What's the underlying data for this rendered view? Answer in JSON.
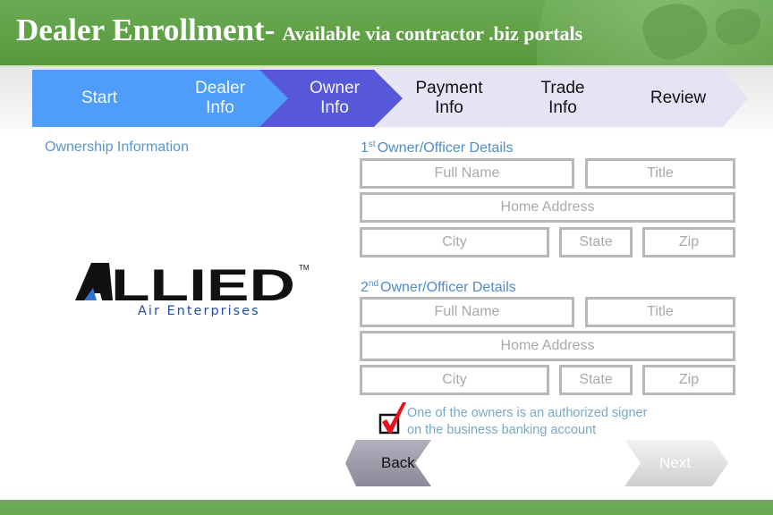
{
  "header": {
    "title": "Dealer Enrollment-",
    "subtitle": "Available via contractor .biz portals"
  },
  "steps": [
    {
      "label_line1": "Start",
      "label_line2": "",
      "state": "done"
    },
    {
      "label_line1": "Dealer",
      "label_line2": "Info",
      "state": "done"
    },
    {
      "label_line1": "Owner",
      "label_line2": "Info",
      "state": "current"
    },
    {
      "label_line1": "Payment",
      "label_line2": "Info",
      "state": "todo"
    },
    {
      "label_line1": "Trade",
      "label_line2": "Info",
      "state": "todo"
    },
    {
      "label_line1": "Review",
      "label_line2": "",
      "state": "todo"
    }
  ],
  "colors": {
    "done": "#4f9dfa",
    "current": "#5757d9",
    "todo": "#e2e2f2",
    "header_green": "#63a34a",
    "heading_blue": "#4f8cc9",
    "field_border": "#b8b8bc",
    "check_red": "#e8101a"
  },
  "section_title": "Ownership Information",
  "logo": {
    "brand": "ALLIED",
    "tagline": "Air Enterprises",
    "trademark": "TM"
  },
  "owner1": {
    "ordinal_num": "1",
    "ordinal_suffix": "st",
    "heading": "Owner/Officer Details",
    "full_name_placeholder": "Full Name",
    "title_placeholder": "Title",
    "address_placeholder": "Home Address",
    "city_placeholder": "City",
    "state_placeholder": "State",
    "zip_placeholder": "Zip"
  },
  "owner2": {
    "ordinal_num": "2",
    "ordinal_suffix": "nd",
    "heading": "Owner/Officer Details",
    "full_name_placeholder": "Full Name",
    "title_placeholder": "Title",
    "address_placeholder": "Home Address",
    "city_placeholder": "City",
    "state_placeholder": "State",
    "zip_placeholder": "Zip"
  },
  "signer": {
    "checked": true,
    "line1": "One of the owners is an authorized signer",
    "line2": "on the business banking account"
  },
  "nav": {
    "back_label": "Back",
    "next_label": "Next"
  }
}
